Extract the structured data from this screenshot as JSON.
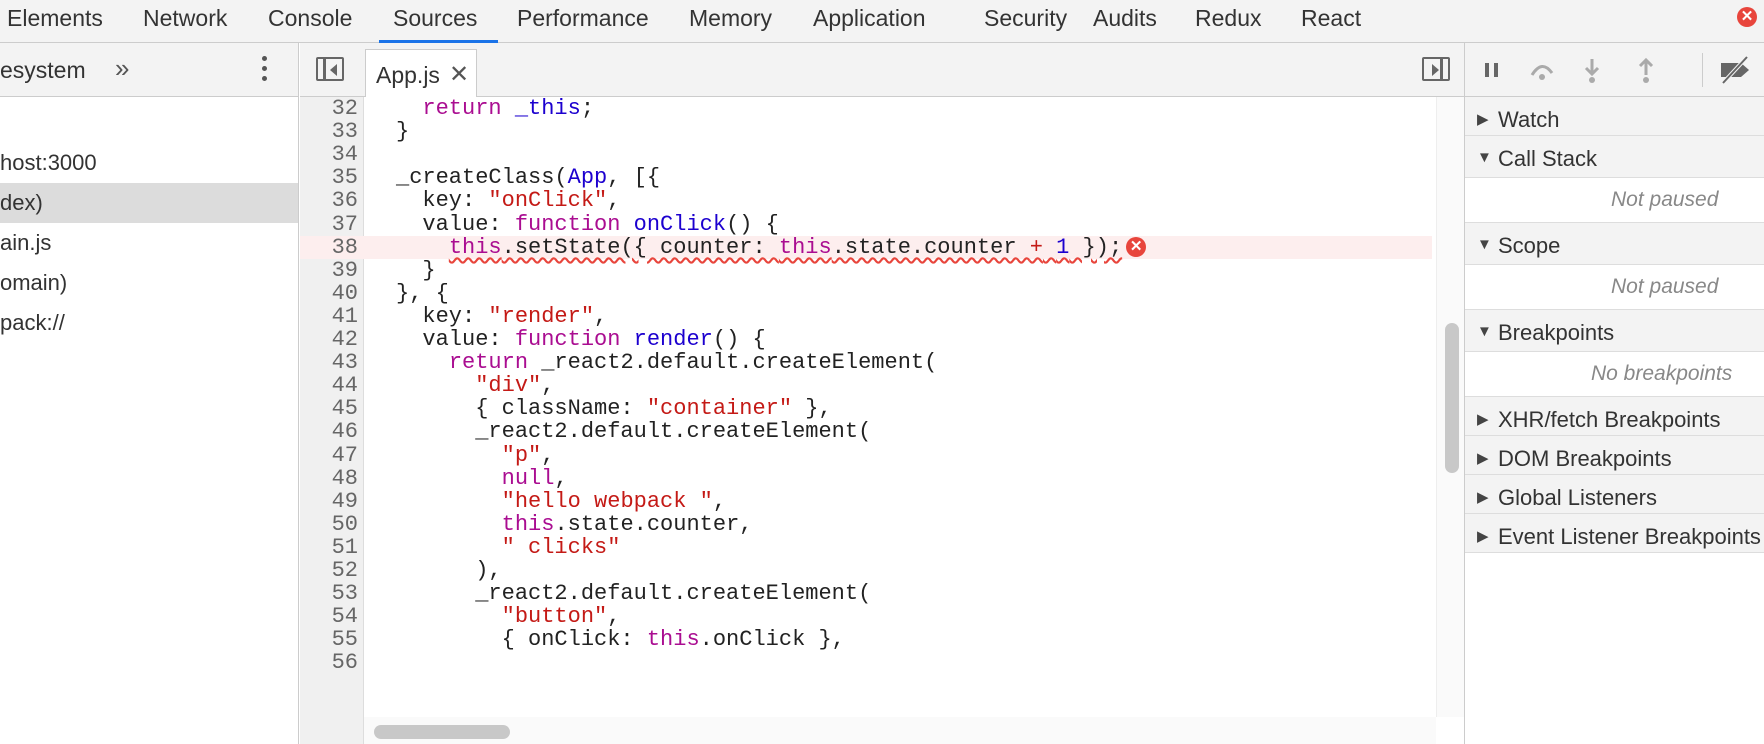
{
  "top_tabs": [
    "Elements",
    "Network",
    "Console",
    "Sources",
    "Performance",
    "Memory",
    "Application",
    "Security",
    "Audits",
    "Redux",
    "React"
  ],
  "active_tab": "Sources",
  "close_glyph": "✕",
  "navigator": {
    "tab_label": "esystem",
    "more_glyph": "»",
    "items": [
      "host:3000",
      "dex)",
      "ain.js",
      "omain)",
      "pack://"
    ],
    "selected_index": 1
  },
  "editor": {
    "file_tab": "App.js",
    "close_glyph": "✕",
    "lines": [
      {
        "n": "32",
        "code": [
          {
            "t": "  "
          },
          {
            "t": "return",
            "c": "kw"
          },
          {
            "t": " "
          },
          {
            "t": "_this",
            "c": "fn"
          },
          {
            "t": ";"
          }
        ]
      },
      {
        "n": "33",
        "code": [
          {
            "t": "}"
          }
        ]
      },
      {
        "n": "34",
        "code": []
      },
      {
        "n": "35",
        "code": [
          {
            "t": "_createClass("
          },
          {
            "t": "App",
            "c": "fn"
          },
          {
            "t": ", [{"
          }
        ]
      },
      {
        "n": "36",
        "code": [
          {
            "t": "  key: "
          },
          {
            "t": "\"onClick\"",
            "c": "str"
          },
          {
            "t": ","
          }
        ]
      },
      {
        "n": "37",
        "code": [
          {
            "t": "  value: "
          },
          {
            "t": "function",
            "c": "kw"
          },
          {
            "t": " "
          },
          {
            "t": "onClick",
            "c": "fn"
          },
          {
            "t": "() {"
          }
        ]
      },
      {
        "n": "38",
        "code": [
          {
            "t": "    "
          },
          {
            "t": "this",
            "c": "kw",
            "sq": true
          },
          {
            "t": ".setState({ counter: ",
            "sq": true
          },
          {
            "t": "this",
            "c": "kw",
            "sq": true
          },
          {
            "t": ".state.counter ",
            "sq": true
          },
          {
            "t": "+",
            "c": "str",
            "sq": true
          },
          {
            "t": " ",
            "sq": true
          },
          {
            "t": "1",
            "c": "num-lit",
            "sq": true
          },
          {
            "t": " });",
            "sq": true
          }
        ],
        "error": true
      },
      {
        "n": "39",
        "code": [
          {
            "t": "  }"
          }
        ]
      },
      {
        "n": "40",
        "code": [
          {
            "t": "}, {"
          }
        ]
      },
      {
        "n": "41",
        "code": [
          {
            "t": "  key: "
          },
          {
            "t": "\"render\"",
            "c": "str"
          },
          {
            "t": ","
          }
        ]
      },
      {
        "n": "42",
        "code": [
          {
            "t": "  value: "
          },
          {
            "t": "function",
            "c": "kw"
          },
          {
            "t": " "
          },
          {
            "t": "render",
            "c": "fn"
          },
          {
            "t": "() {"
          }
        ]
      },
      {
        "n": "43",
        "code": [
          {
            "t": "    "
          },
          {
            "t": "return",
            "c": "kw"
          },
          {
            "t": " _react2.default.createElement("
          }
        ]
      },
      {
        "n": "44",
        "code": [
          {
            "t": "      "
          },
          {
            "t": "\"div\"",
            "c": "str"
          },
          {
            "t": ","
          }
        ]
      },
      {
        "n": "45",
        "code": [
          {
            "t": "      { className: "
          },
          {
            "t": "\"container\"",
            "c": "str"
          },
          {
            "t": " },"
          }
        ]
      },
      {
        "n": "46",
        "code": [
          {
            "t": "      _react2.default.createElement("
          }
        ]
      },
      {
        "n": "47",
        "code": [
          {
            "t": "        "
          },
          {
            "t": "\"p\"",
            "c": "str"
          },
          {
            "t": ","
          }
        ]
      },
      {
        "n": "48",
        "code": [
          {
            "t": "        "
          },
          {
            "t": "null",
            "c": "kw"
          },
          {
            "t": ","
          }
        ]
      },
      {
        "n": "49",
        "code": [
          {
            "t": "        "
          },
          {
            "t": "\"hello webpack \"",
            "c": "str"
          },
          {
            "t": ","
          }
        ]
      },
      {
        "n": "50",
        "code": [
          {
            "t": "        "
          },
          {
            "t": "this",
            "c": "kw"
          },
          {
            "t": ".state.counter,"
          }
        ]
      },
      {
        "n": "51",
        "code": [
          {
            "t": "        "
          },
          {
            "t": "\" clicks\"",
            "c": "str"
          }
        ]
      },
      {
        "n": "52",
        "code": [
          {
            "t": "      ),"
          }
        ]
      },
      {
        "n": "53",
        "code": [
          {
            "t": "      _react2.default.createElement("
          }
        ]
      },
      {
        "n": "54",
        "code": [
          {
            "t": "        "
          },
          {
            "t": "\"button\"",
            "c": "str"
          },
          {
            "t": ","
          }
        ]
      },
      {
        "n": "55",
        "code": [
          {
            "t": "        { onClick: "
          },
          {
            "t": "this",
            "c": "kw"
          },
          {
            "t": ".onClick },"
          }
        ]
      },
      {
        "n": "56",
        "code": []
      }
    ]
  },
  "debugger": {
    "sections": [
      {
        "title": "Watch",
        "expanded": false
      },
      {
        "title": "Call Stack",
        "expanded": true,
        "message": "Not paused"
      },
      {
        "title": "Scope",
        "expanded": true,
        "message": "Not paused"
      },
      {
        "title": "Breakpoints",
        "expanded": true,
        "message": "No breakpoints"
      },
      {
        "title": "XHR/fetch Breakpoints",
        "expanded": false
      },
      {
        "title": "DOM Breakpoints",
        "expanded": false
      },
      {
        "title": "Global Listeners",
        "expanded": false
      },
      {
        "title": "Event Listener Breakpoints",
        "expanded": false
      }
    ]
  },
  "colors": {
    "accent": "#1a73e8",
    "error": "#e8453c",
    "keyword": "#aa0d91",
    "string": "#c41a16",
    "identifier": "#1c00cf"
  }
}
